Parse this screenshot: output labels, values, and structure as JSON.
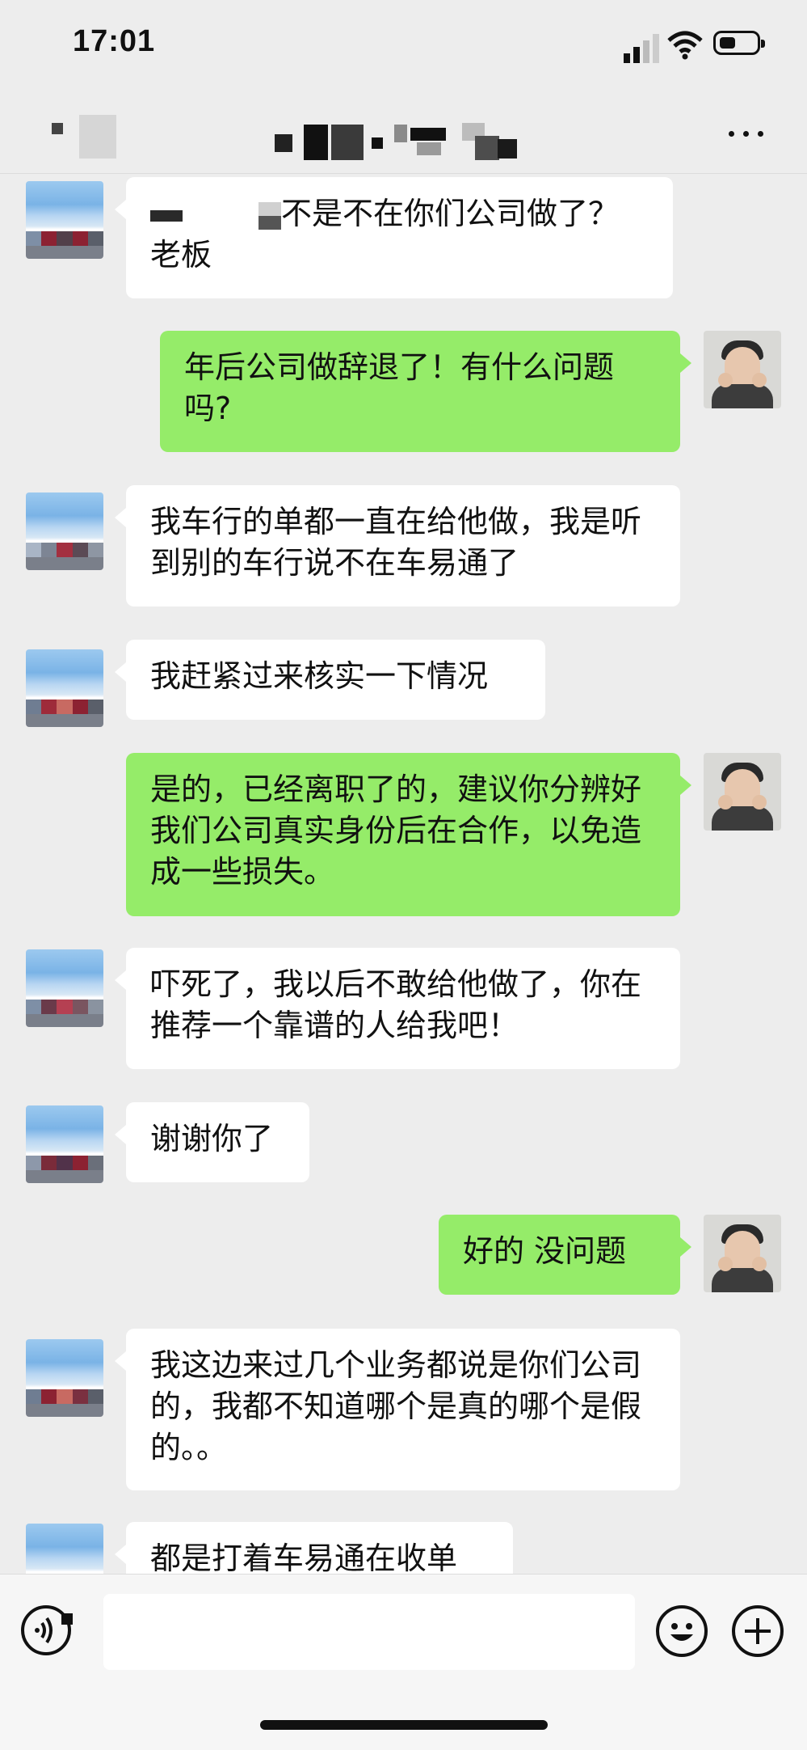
{
  "status_bar": {
    "time": "17:01",
    "battery_level_percent": 45
  },
  "nav": {
    "more_icon": "more-dots-icon"
  },
  "messages": [
    {
      "side": "in",
      "text": "不是不在你们公司做了？老板"
    },
    {
      "side": "out",
      "text": "年后公司做辞退了！有什么问题吗?"
    },
    {
      "side": "in",
      "text": "我车行的单都一直在给他做，我是听到别的车行说不在车易通了"
    },
    {
      "side": "in",
      "text": "我赶紧过来核实一下情况"
    },
    {
      "side": "out",
      "text": "是的，已经离职了的，建议你分辨好我们公司真实身份后在合作，以免造成一些损失。"
    },
    {
      "side": "in",
      "text": "吓死了，我以后不敢给他做了，你在推荐一个靠谱的人给我吧！"
    },
    {
      "side": "in",
      "text": "谢谢你了"
    },
    {
      "side": "out",
      "text": "好的 没问题"
    },
    {
      "side": "in",
      "text": "我这边来过几个业务都说是你们公司的，我都不知道哪个是真的哪个是假的。。"
    },
    {
      "side": "in",
      "text": "都是打着车易通在收单"
    }
  ],
  "input_bar": {
    "text_value": "",
    "voice_icon": "voice-icon",
    "emoji_icon": "emoji-icon",
    "plus_icon": "plus-icon"
  },
  "colors": {
    "background": "#ededed",
    "incoming_bubble": "#ffffff",
    "outgoing_bubble": "#95ec69"
  }
}
